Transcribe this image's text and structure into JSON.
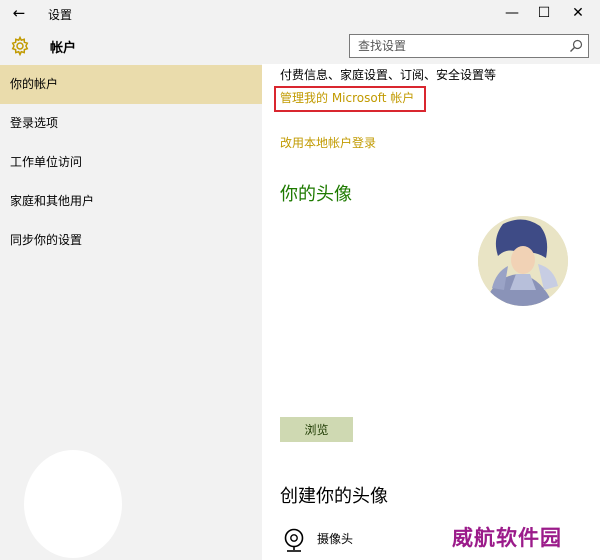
{
  "window": {
    "title": "设置",
    "back_glyph": "←",
    "minimize_glyph": "—",
    "maximize_glyph": "☐",
    "close_glyph": "✕"
  },
  "header": {
    "title": "帐户",
    "search_placeholder": "查找设置"
  },
  "sidebar": {
    "items": [
      {
        "label": "你的帐户",
        "active": true
      },
      {
        "label": "登录选项",
        "active": false
      },
      {
        "label": "工作单位访问",
        "active": false
      },
      {
        "label": "家庭和其他用户",
        "active": false
      },
      {
        "label": "同步你的设置",
        "active": false
      }
    ]
  },
  "content": {
    "cut_text": "付费信息、家庭设置、订阅、安全设置等",
    "manage_link": "管理我的 Microsoft 帐户",
    "local_link": "改用本地帐户登录",
    "avatar_heading": "你的头像",
    "browse_label": "浏览",
    "create_heading": "创建你的头像",
    "camera_label": "摄像头"
  },
  "watermark": "威航软件园",
  "colors": {
    "accent_link": "#c19a00",
    "heading_green": "#1e7a00",
    "active_nav": "#eadcac",
    "highlight_red": "#d9262f",
    "watermark": "#9b1b8a"
  },
  "icons": [
    "back-arrow-icon",
    "gear-icon",
    "search-icon",
    "camera-icon"
  ]
}
